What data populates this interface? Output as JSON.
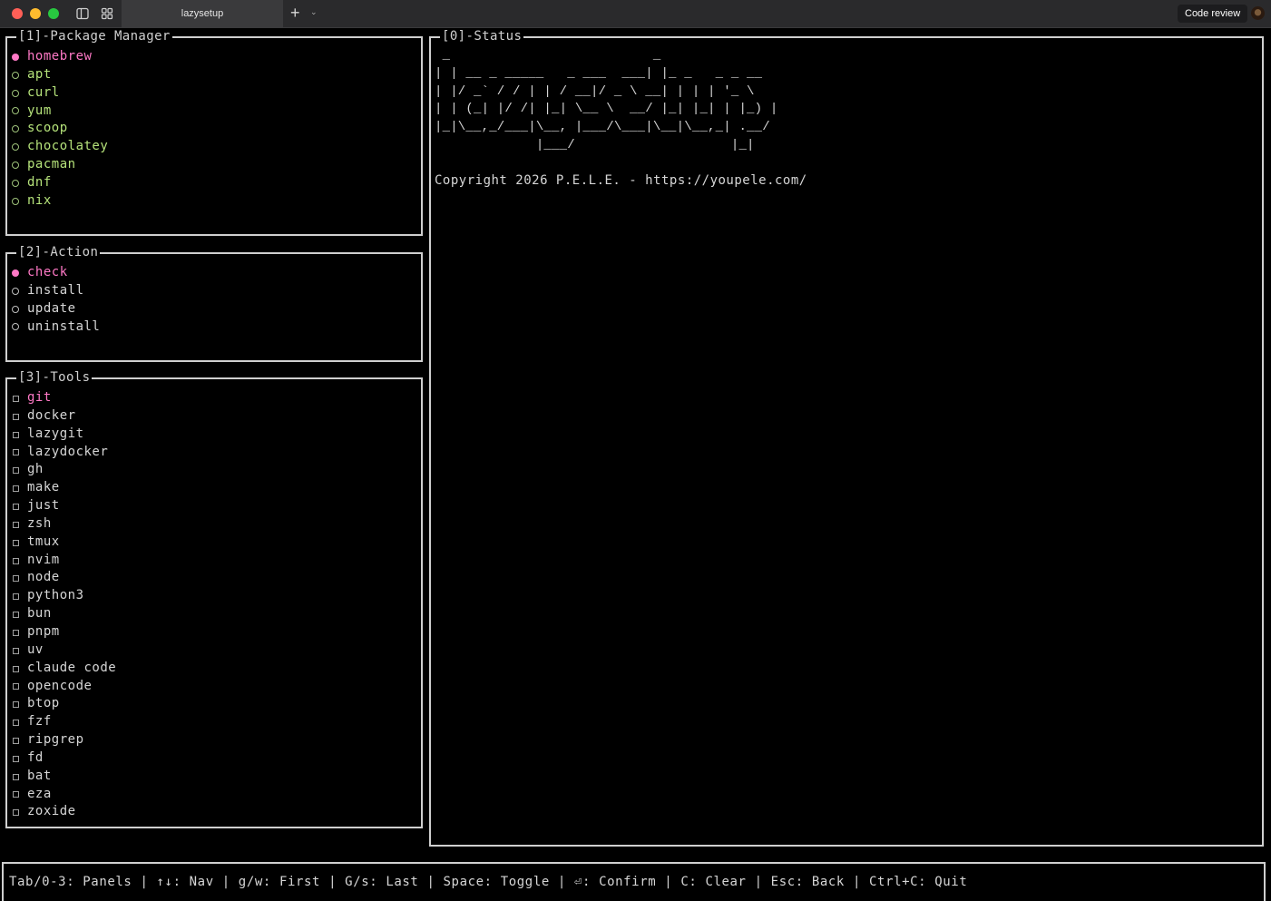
{
  "window": {
    "tab_title": "lazysetup",
    "new_tab_label": "+",
    "code_review_label": "Code review"
  },
  "panels": {
    "package_manager": {
      "title": "[1]-Package Manager",
      "items": [
        {
          "label": "homebrew",
          "selected": true
        },
        {
          "label": "apt",
          "selected": false
        },
        {
          "label": "curl",
          "selected": false
        },
        {
          "label": "yum",
          "selected": false
        },
        {
          "label": "scoop",
          "selected": false
        },
        {
          "label": "chocolatey",
          "selected": false
        },
        {
          "label": "pacman",
          "selected": false
        },
        {
          "label": "dnf",
          "selected": false
        },
        {
          "label": "nix",
          "selected": false
        }
      ]
    },
    "action": {
      "title": "[2]-Action",
      "items": [
        {
          "label": "check",
          "selected": true
        },
        {
          "label": "install",
          "selected": false
        },
        {
          "label": "update",
          "selected": false
        },
        {
          "label": "uninstall",
          "selected": false
        }
      ]
    },
    "tools": {
      "title": "[3]-Tools",
      "items": [
        "git",
        "docker",
        "lazygit",
        "lazydocker",
        "gh",
        "make",
        "just",
        "zsh",
        "tmux",
        "nvim",
        "node",
        "python3",
        "bun",
        "pnpm",
        "uv",
        "claude code",
        "opencode",
        "btop",
        "fzf",
        "ripgrep",
        "fd",
        "bat",
        "eza",
        "zoxide"
      ],
      "cursor_index": 0
    },
    "status": {
      "title": "[0]-Status",
      "ascii_art": " _                          _\n| | __ _ _____   _ ___  ___| |_ _   _ _ __\n| |/ _` / / | | / __|/ _ \\ __| | | | '_ \\\n| | (_| |/ /| |_| \\__ \\  __/ |_| |_| | |_) |\n|_|\\__,_/___|\\__, |___/\\___|\\__|\\__,_| .__/\n             |___/                    |_|",
      "copyright": "Copyright 2026 P.E.L.E. - https://youpele.com/"
    }
  },
  "helpbar": {
    "text": "Tab/0-3: Panels | ↑↓: Nav | g/w: First | G/s: Last | Space: Toggle | ⏎: Confirm | C: Clear | Esc: Back | Ctrl+C: Quit"
  },
  "colors": {
    "accent_selected": "#ff79c6",
    "package_item": "#b5e27a",
    "text": "#d6d6d6",
    "border": "#cfcfcf"
  },
  "icons": [
    "close-icon",
    "minimize-icon",
    "zoom-icon",
    "sidebar-toggle-icon",
    "grid-icon",
    "plus-icon",
    "chevron-down-icon",
    "avatar"
  ]
}
